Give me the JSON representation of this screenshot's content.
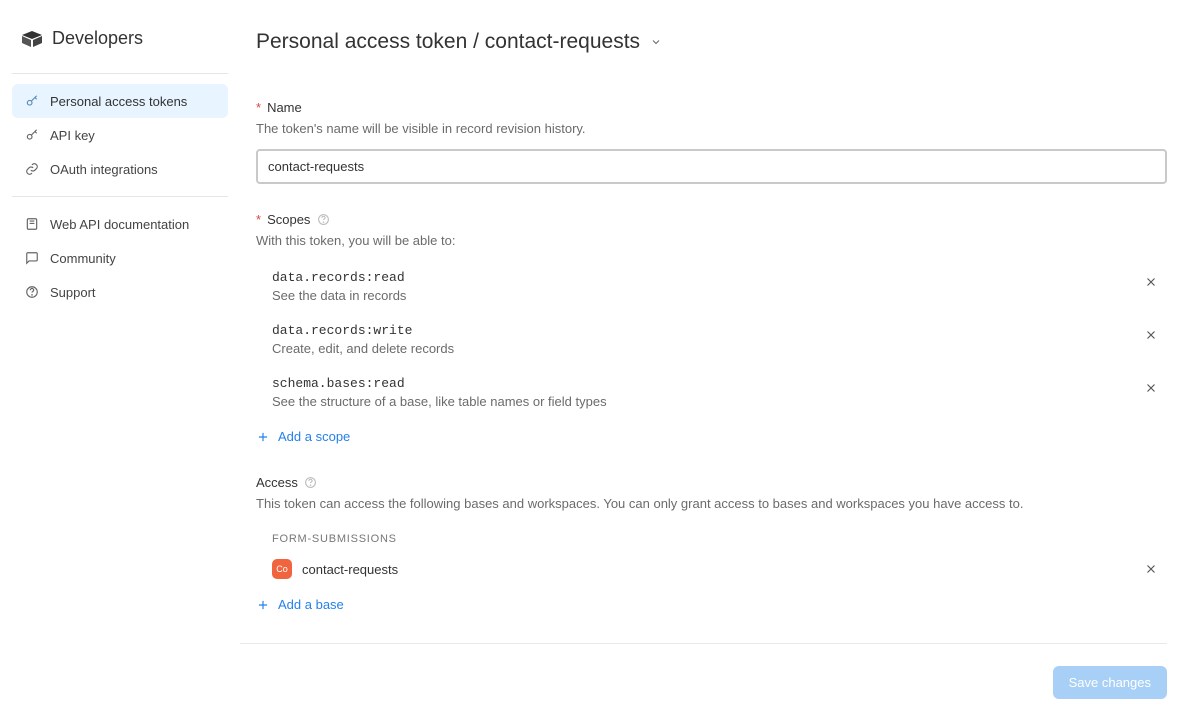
{
  "logo": {
    "text": "Developers"
  },
  "sidebar": {
    "main": [
      {
        "label": "Personal access tokens",
        "icon": "key"
      },
      {
        "label": "API key",
        "icon": "key"
      },
      {
        "label": "OAuth integrations",
        "icon": "link"
      }
    ],
    "secondary": [
      {
        "label": "Web API documentation",
        "icon": "book"
      },
      {
        "label": "Community",
        "icon": "chat"
      },
      {
        "label": "Support",
        "icon": "help"
      }
    ]
  },
  "header": {
    "title": "Personal access token / contact-requests"
  },
  "form": {
    "name": {
      "label": "Name",
      "help": "The token's name will be visible in record revision history.",
      "value": "contact-requests"
    },
    "scopes": {
      "label": "Scopes",
      "help": "With this token, you will be able to:",
      "items": [
        {
          "code": "data.records:read",
          "desc": "See the data in records"
        },
        {
          "code": "data.records:write",
          "desc": "Create, edit, and delete records"
        },
        {
          "code": "schema.bases:read",
          "desc": "See the structure of a base, like table names or field types"
        }
      ],
      "add_label": "Add a scope"
    },
    "access": {
      "label": "Access",
      "help": "This token can access the following bases and workspaces. You can only grant access to bases and workspaces you have access to.",
      "groups": [
        {
          "group_label": "FORM-SUBMISSIONS",
          "bases": [
            {
              "name": "contact-requests",
              "icon_text": "Co"
            }
          ]
        }
      ],
      "add_label": "Add a base"
    }
  },
  "footer": {
    "save_label": "Save changes"
  }
}
